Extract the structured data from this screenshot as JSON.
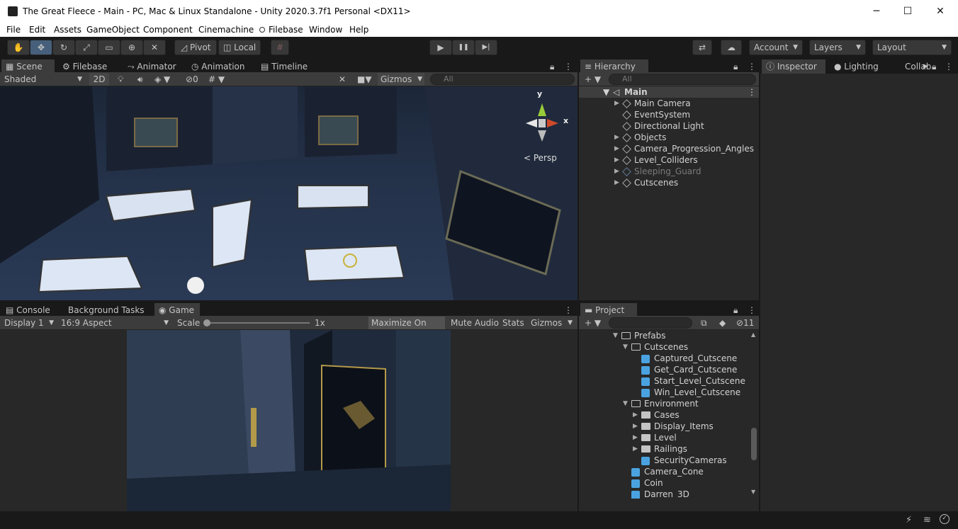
{
  "window": {
    "title": "The Great Fleece - Main - PC, Mac & Linux Standalone - Unity 2020.3.7f1 Personal <DX11>",
    "minimize": "─",
    "maximize": "☐",
    "close": "✕"
  },
  "menu": [
    "File",
    "Edit",
    "Assets",
    "GameObject",
    "Component",
    "Cinemachine",
    "Filebase",
    "Window",
    "Help"
  ],
  "toolbar": {
    "pivot": "Pivot",
    "local": "Local",
    "play": "▶",
    "pause": "❚❚",
    "step": "▶|",
    "account": "Account",
    "layers": "Layers",
    "layout": "Layout"
  },
  "scene_tabs": {
    "scene": "Scene",
    "filebase": "Filebase",
    "animator": "Animator",
    "animation": "Animation",
    "timeline": "Timeline"
  },
  "scene_toolbar": {
    "shading": "Shaded",
    "mode2d": "2D",
    "hidden_count": "0",
    "gizmos": "Gizmos",
    "search_placeholder": "All"
  },
  "scene_view": {
    "axis_y": "y",
    "axis_x": "x",
    "projection": "< Persp"
  },
  "game_tabs": {
    "console": "Console",
    "background_tasks": "Background Tasks",
    "game": "Game"
  },
  "game_toolbar": {
    "display": "Display 1",
    "aspect": "16:9 Aspect",
    "scale_label": "Scale",
    "scale_value": "1x",
    "maximize": "Maximize On Play",
    "mute": "Mute Audio",
    "stats": "Stats",
    "gizmos": "Gizmos"
  },
  "hierarchy": {
    "tab": "Hierarchy",
    "search_placeholder": "All",
    "root": "Main",
    "items": [
      {
        "label": "Main Camera",
        "expand": true,
        "dim": false
      },
      {
        "label": "EventSystem",
        "expand": false,
        "dim": false
      },
      {
        "label": "Directional Light",
        "expand": false,
        "dim": false
      },
      {
        "label": "Objects",
        "expand": true,
        "dim": false
      },
      {
        "label": "Camera_Progression_Angles",
        "expand": true,
        "dim": false
      },
      {
        "label": "Level_Colliders",
        "expand": true,
        "dim": false
      },
      {
        "label": "Sleeping_Guard",
        "expand": true,
        "dim": true
      },
      {
        "label": "Cutscenes",
        "expand": true,
        "dim": false
      }
    ]
  },
  "inspector_tabs": {
    "inspector": "Inspector",
    "lighting": "Lighting",
    "collab": "Collab"
  },
  "project": {
    "tab": "Project",
    "hidden_count": "11",
    "items": [
      {
        "label": "Prefabs",
        "type": "folder-open",
        "arrow": "▼",
        "indent": 0
      },
      {
        "label": "Cutscenes",
        "type": "folder-open",
        "arrow": "▼",
        "indent": 1
      },
      {
        "label": "Captured_Cutscene",
        "type": "prefab",
        "arrow": "",
        "indent": 2
      },
      {
        "label": "Get_Card_Cutscene",
        "type": "prefab",
        "arrow": "",
        "indent": 2
      },
      {
        "label": "Start_Level_Cutscene",
        "type": "prefab",
        "arrow": "",
        "indent": 2
      },
      {
        "label": "Win_Level_Cutscene",
        "type": "prefab",
        "arrow": "",
        "indent": 2
      },
      {
        "label": "Environment",
        "type": "folder-open",
        "arrow": "▼",
        "indent": 1
      },
      {
        "label": "Cases",
        "type": "folder",
        "arrow": "▶",
        "indent": 2
      },
      {
        "label": "Display_Items",
        "type": "folder",
        "arrow": "▶",
        "indent": 2
      },
      {
        "label": "Level",
        "type": "folder",
        "arrow": "▶",
        "indent": 2
      },
      {
        "label": "Railings",
        "type": "folder",
        "arrow": "▶",
        "indent": 2
      },
      {
        "label": "SecurityCameras",
        "type": "prefab",
        "arrow": "",
        "indent": 2
      },
      {
        "label": "Camera_Cone",
        "type": "prefab",
        "arrow": "",
        "indent": 1
      },
      {
        "label": "Coin",
        "type": "prefab",
        "arrow": "",
        "indent": 1
      },
      {
        "label": "Darren_3D",
        "type": "prefab",
        "arrow": "",
        "indent": 1
      }
    ]
  }
}
